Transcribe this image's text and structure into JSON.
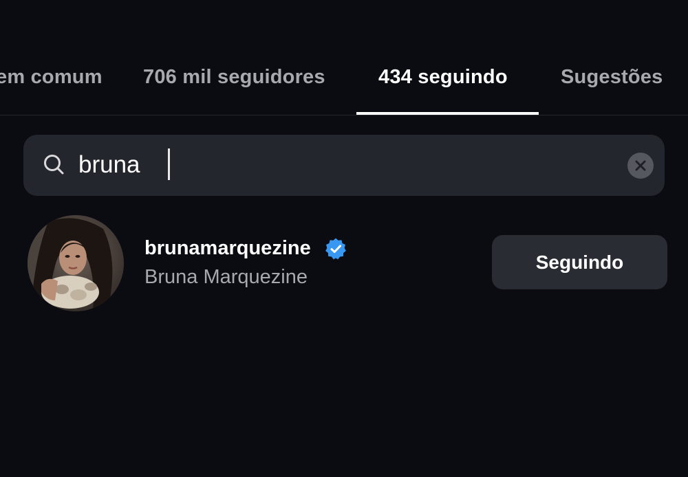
{
  "tabs": [
    {
      "label": "em comum",
      "active": false
    },
    {
      "label": "706 mil seguidores",
      "active": false
    },
    {
      "label": "434 seguindo",
      "active": true
    },
    {
      "label": "Sugestões",
      "active": false
    }
  ],
  "search": {
    "value": "bruna",
    "icon": "search-icon",
    "clear_icon": "clear-icon"
  },
  "result": {
    "username": "brunamarquezine",
    "full_name": "Bruna Marquezine",
    "verified": true,
    "button_label": "Seguindo"
  },
  "colors": {
    "background": "#0b0c12",
    "search_bg": "#24262d",
    "button_bg": "#2a2c33",
    "verified_blue": "#3897f0",
    "muted_text": "#a8a9ae"
  }
}
